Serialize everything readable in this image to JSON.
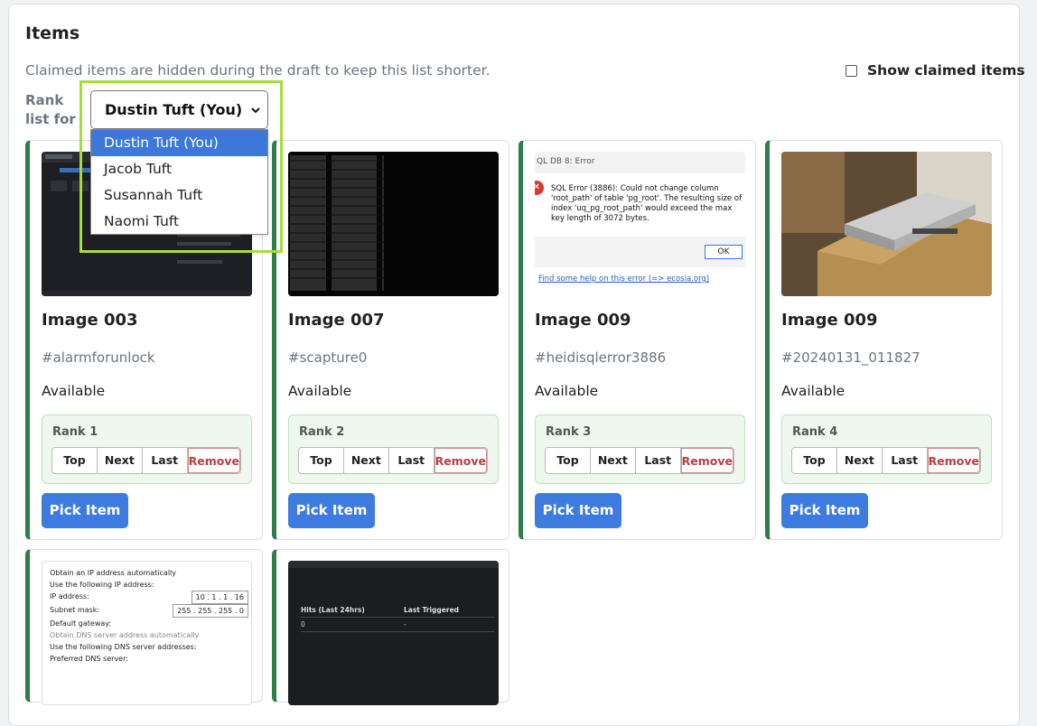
{
  "section": {
    "title": "Items",
    "subtitle": "Claimed items are hidden during the draft to keep this list shorter.",
    "show_claimed_label": "Show claimed items",
    "show_claimed_checked": false
  },
  "rank_list": {
    "label": "Rank list for",
    "selected": "Dustin Tuft (You)",
    "options": [
      "Dustin Tuft (You)",
      "Jacob Tuft",
      "Susannah Tuft",
      "Naomi Tuft"
    ]
  },
  "items": [
    {
      "title": "Image 003",
      "tag": "#alarmforunlock",
      "status": "Available",
      "rank": "Rank 1"
    },
    {
      "title": "Image 007",
      "tag": "#scapture0",
      "status": "Available",
      "rank": "Rank 2"
    },
    {
      "title": "Image 009",
      "tag": "#heidisqlerror3886",
      "status": "Available",
      "rank": "Rank 3"
    },
    {
      "title": "Image 009",
      "tag": "#20240131_011827",
      "status": "Available",
      "rank": "Rank 4"
    }
  ],
  "rank_buttons": {
    "top": "Top",
    "next": "Next",
    "last": "Last",
    "remove": "Remove"
  },
  "pick_label": "Pick Item",
  "thumbs": {
    "sql_error_title": "QL DB 8: Error",
    "sql_error_text": "SQL Error (3886): Could not change column 'root_path' of table 'pg_root'. The resulting size of index 'uq_pg_root_path' would exceed the max key length of 3072 bytes.",
    "sql_ok": "OK",
    "sql_help": "Find some help on this error (=> ecosia.org)",
    "net_obtain_auto": "Obtain an IP address automatically",
    "net_use_following": "Use the following IP address:",
    "net_ip_label": "IP address:",
    "net_ip": "10 . 1 . 1 . 16",
    "net_mask_label": "Subnet mask:",
    "net_mask": "255 . 255 . 255 . 0",
    "net_gateway_label": "Default gateway:",
    "net_dns_auto": "Obtain DNS server address automatically",
    "net_dns_use": "Use the following DNS server addresses:",
    "net_dns_pref": "Preferred DNS server:",
    "hits_col1": "Hits (Last 24hrs)",
    "hits_col2": "Last Triggered",
    "hits_val1": "0",
    "hits_val2": "-"
  },
  "colors": {
    "accent": "#3d7be0",
    "card_border": "#2f7d4a",
    "rank_bg": "#eef8ef",
    "highlight": "#a6dc3c",
    "remove": "#b54040"
  }
}
